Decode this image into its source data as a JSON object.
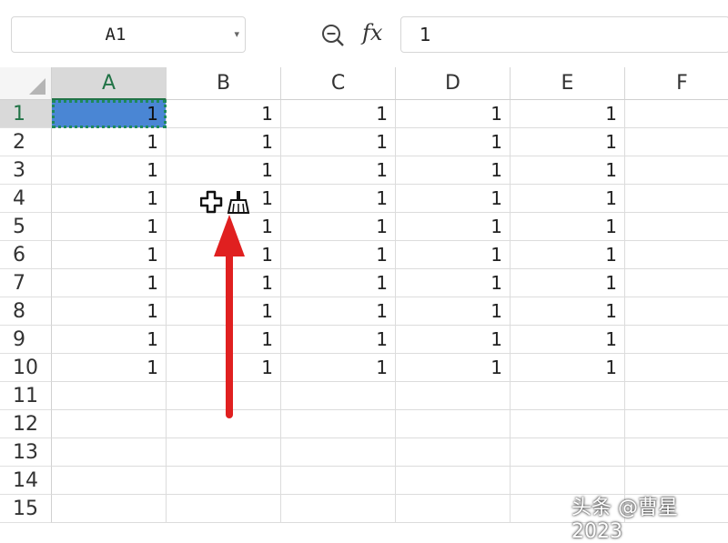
{
  "formula_bar": {
    "name_box": "A1",
    "fx_label": "fx",
    "formula_value": "1"
  },
  "columns": [
    "A",
    "B",
    "C",
    "D",
    "E",
    "F"
  ],
  "rows": [
    "1",
    "2",
    "3",
    "4",
    "5",
    "6",
    "7",
    "8",
    "9",
    "10",
    "11",
    "12",
    "13",
    "14",
    "15"
  ],
  "cells": [
    [
      "1",
      "1",
      "1",
      "1",
      "1",
      ""
    ],
    [
      "1",
      "1",
      "1",
      "1",
      "1",
      ""
    ],
    [
      "1",
      "1",
      "1",
      "1",
      "1",
      ""
    ],
    [
      "1",
      "1",
      "1",
      "1",
      "1",
      ""
    ],
    [
      "1",
      "1",
      "1",
      "1",
      "1",
      ""
    ],
    [
      "1",
      "1",
      "1",
      "1",
      "1",
      ""
    ],
    [
      "1",
      "1",
      "1",
      "1",
      "1",
      ""
    ],
    [
      "1",
      "1",
      "1",
      "1",
      "1",
      ""
    ],
    [
      "1",
      "1",
      "1",
      "1",
      "1",
      ""
    ],
    [
      "1",
      "1",
      "1",
      "1",
      "1",
      ""
    ],
    [
      "",
      "",
      "",
      "",
      "",
      ""
    ],
    [
      "",
      "",
      "",
      "",
      "",
      ""
    ],
    [
      "",
      "",
      "",
      "",
      "",
      ""
    ],
    [
      "",
      "",
      "",
      "",
      "",
      ""
    ],
    [
      "",
      "",
      "",
      "",
      "",
      ""
    ]
  ],
  "selection": {
    "column": "A",
    "row": "1"
  },
  "accent_color": "#217346",
  "arrow_color": "#e02020",
  "watermark": "头条 @曹星2023"
}
